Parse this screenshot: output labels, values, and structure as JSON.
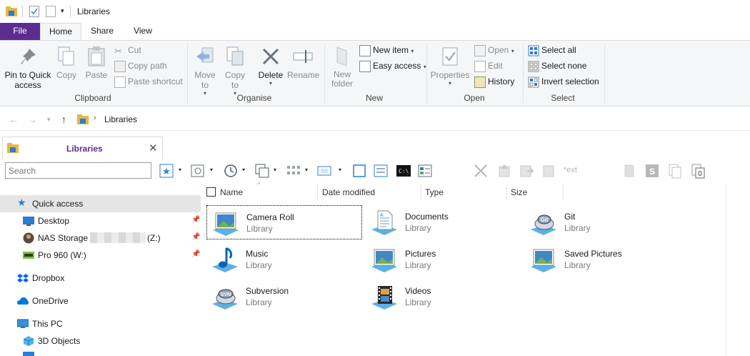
{
  "window": {
    "title": "Libraries"
  },
  "ribbon": {
    "tabs": [
      "File",
      "Home",
      "Share",
      "View"
    ],
    "active_tab": "Home",
    "groups": {
      "clipboard": {
        "label": "Clipboard",
        "pin": "Pin to Quick access",
        "copy": "Copy",
        "paste": "Paste",
        "cut": "Cut",
        "copy_path": "Copy path",
        "paste_shortcut": "Paste shortcut"
      },
      "organise": {
        "label": "Organise",
        "move_to": "Move to",
        "copy_to": "Copy to",
        "delete": "Delete",
        "rename": "Rename"
      },
      "new": {
        "label": "New",
        "new_folder": "New folder",
        "new_item": "New item",
        "easy_access": "Easy access"
      },
      "open": {
        "label": "Open",
        "properties": "Properties",
        "open": "Open",
        "edit": "Edit",
        "history": "History"
      },
      "select": {
        "label": "Select",
        "select_all": "Select all",
        "select_none": "Select none",
        "invert": "Invert selection"
      }
    }
  },
  "address": {
    "crumb": "Libraries"
  },
  "doc_tab": {
    "label": "Libraries"
  },
  "search": {
    "placeholder": "Search"
  },
  "toolbar": {
    "ext_label": "*ext"
  },
  "nav": {
    "items": [
      {
        "label": "Quick access",
        "icon": "star-icon",
        "selected": true
      },
      {
        "label": "Desktop",
        "icon": "desktop-icon",
        "pinned": true
      },
      {
        "label": "NAS Storage (\\",
        "label_tail": "(Z:)",
        "icon": "nas-icon",
        "pinned": true
      },
      {
        "label": "Pro 960 (W:)",
        "icon": "drive-icon",
        "pinned": true
      },
      {
        "label": "Dropbox",
        "icon": "dropbox-icon"
      },
      {
        "label": "OneDrive",
        "icon": "onedrive-icon"
      },
      {
        "label": "This PC",
        "icon": "pc-icon"
      },
      {
        "label": "3D Objects",
        "icon": "3d-objects-icon"
      }
    ]
  },
  "columns": [
    "Name",
    "Date modified",
    "Type",
    "Size"
  ],
  "libraries": [
    {
      "name": "Camera Roll",
      "type": "Library",
      "icon": "picture-library-icon",
      "selected": true
    },
    {
      "name": "Documents",
      "type": "Library",
      "icon": "documents-library-icon"
    },
    {
      "name": "Git",
      "type": "Library",
      "icon": "git-library-icon"
    },
    {
      "name": "Music",
      "type": "Library",
      "icon": "music-library-icon"
    },
    {
      "name": "Pictures",
      "type": "Library",
      "icon": "picture-library-icon"
    },
    {
      "name": "Saved Pictures",
      "type": "Library",
      "icon": "picture-library-icon"
    },
    {
      "name": "Subversion",
      "type": "Library",
      "icon": "svn-library-icon"
    },
    {
      "name": "Videos",
      "type": "Library",
      "icon": "videos-library-icon"
    }
  ],
  "colors": {
    "accent": "#5c2d91",
    "selection": "#e5e5e5",
    "link": "#0078d7"
  }
}
